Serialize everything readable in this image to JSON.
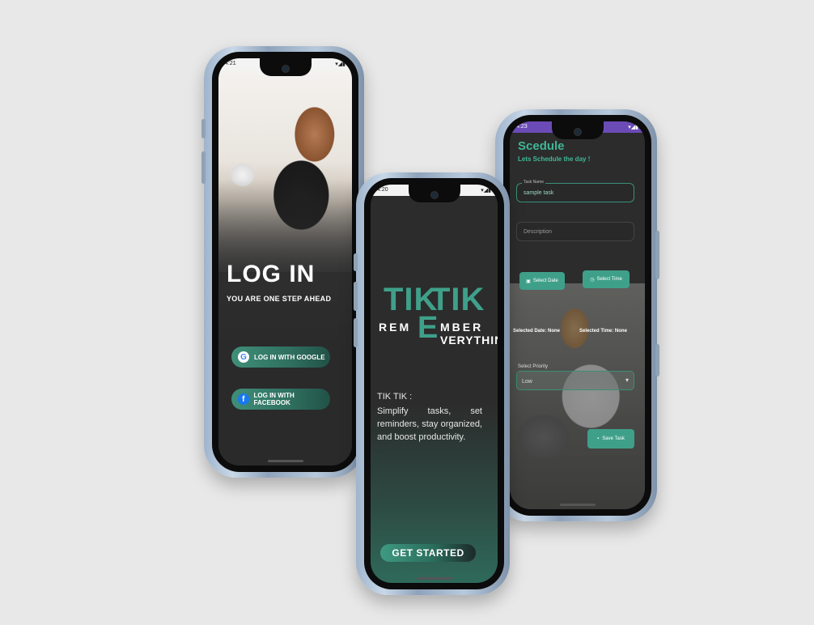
{
  "login": {
    "time": "4:21",
    "title": "LOG IN",
    "subtitle": "YOU ARE ONE STEP AHEAD",
    "google_label": "LOG IN WITH GOOGLE",
    "facebook_label": "LOG IN WITH FACEBOOK",
    "google_glyph": "G",
    "facebook_glyph": "f"
  },
  "welcome": {
    "time": "4:20",
    "logo_tik1": "TIK",
    "logo_tik2": "TIK",
    "logo_rem": "REM",
    "logo_e": "E",
    "logo_mber": "MBER",
    "logo_verything": "VERYTHING",
    "desc_title": "TIK TIK :",
    "desc_body": "Simplify tasks, set reminders, stay organized, and boost productivity.",
    "start_label": "GET STARTED"
  },
  "schedule": {
    "time": "4:23",
    "title": "Scedule",
    "subtitle": "Lets Schedule the day !",
    "task_name_label": "Task Name",
    "task_name_value": "sample task",
    "description_placeholder": "Description",
    "select_date_label": "Select Date",
    "select_time_label": "Select Time",
    "selected_date": "Selected Date: None",
    "selected_time": "Selected Time: None",
    "priority_label": "Select Priority",
    "priority_value": "Low",
    "save_label": "Save Task"
  },
  "colors": {
    "accent": "#3fa08a",
    "accent_text": "#3fb795",
    "status_bar_purple": "#6b4bb6",
    "background": "#e8e8e8"
  }
}
